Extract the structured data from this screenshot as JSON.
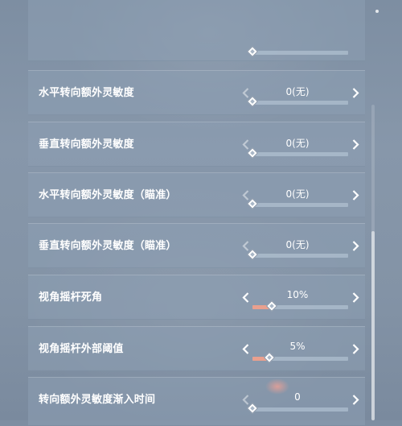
{
  "settings": {
    "rows": [
      {
        "label": "水平转向额外灵敏度",
        "value": "0(无)",
        "level": 0
      },
      {
        "label": "垂直转向额外灵敏度",
        "value": "0(无)",
        "level": 0
      },
      {
        "label": "水平转向额外灵敏度（瞄准）",
        "value": "0(无)",
        "level": 0
      },
      {
        "label": "垂直转向额外灵敏度（瞄准）",
        "value": "0(无)",
        "level": 0
      },
      {
        "label": "视角摇杆死角",
        "value": "10%",
        "level": 0.2
      },
      {
        "label": "视角摇杆外部阈值",
        "value": "5%",
        "level": 0.18
      },
      {
        "label": "转向额外灵敏度渐入时间",
        "value": "0",
        "level": 0
      }
    ],
    "partial_top_row_level": 0
  },
  "scrollbar": {
    "thumb_start": 0.4,
    "thumb_end": 1.0
  },
  "colors": {
    "fill": "#e9a08e",
    "row_bg": "#8c9eb2",
    "text": "#ffffff",
    "arrow_active": "#ffffff",
    "arrow_inactive": "rgba(255,255,255,0.45)"
  },
  "icons": {
    "left_arrow": "chevron-left-icon",
    "right_arrow": "chevron-right-icon",
    "knob": "diamond-slider-knob"
  }
}
